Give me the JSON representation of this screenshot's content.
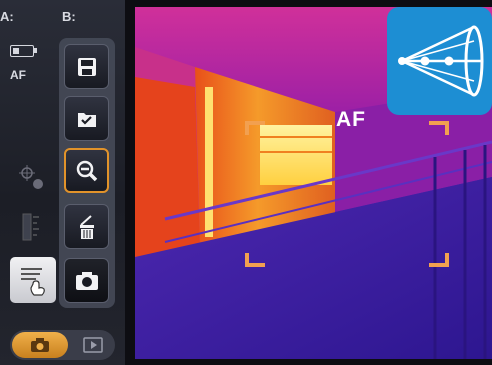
{
  "panel": {
    "label_a": "A:",
    "label_b": "B:",
    "af_status": "AF",
    "battery_level": 0.35
  },
  "menu": {
    "items": [
      {
        "icon": "save-icon",
        "active": false
      },
      {
        "icon": "folder-check-icon",
        "active": false
      },
      {
        "icon": "zoom-out-icon",
        "active": true
      },
      {
        "icon": "delete-edit-icon",
        "active": false
      },
      {
        "icon": "camera-icon",
        "active": false
      }
    ]
  },
  "mode": {
    "selected": "photo",
    "options": [
      "photo",
      "playback"
    ]
  },
  "viewfinder": {
    "af_label": "AF"
  },
  "colors": {
    "accent": "#e2932a",
    "logo_bg": "#1d8ed3"
  }
}
